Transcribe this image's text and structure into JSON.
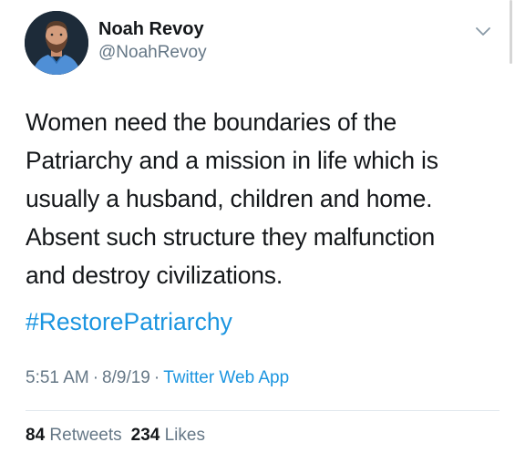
{
  "user": {
    "display_name": "Noah Revoy",
    "handle": "@NoahRevoy",
    "avatar_icon": "profile-photo"
  },
  "tweet": {
    "text_lines": [
      "Women need the boundaries of the",
      "Patriarchy and a mission in life which is",
      "usually a husband, children and home.",
      "Absent such structure they malfunction",
      "and destroy civilizations."
    ],
    "hashtag": "#RestorePatriarchy"
  },
  "meta": {
    "time": "5:51 AM",
    "separator": "·",
    "date": "8/9/19",
    "source": "Twitter Web App"
  },
  "stats": {
    "retweets_count": "84",
    "retweets_label": "Retweets",
    "likes_count": "234",
    "likes_label": "Likes"
  },
  "colors": {
    "text": "#14171a",
    "secondary": "#657786",
    "link": "#1b95e0",
    "divider": "#e1e8ed"
  },
  "icons": {
    "more_menu": "chevron-down-icon"
  }
}
